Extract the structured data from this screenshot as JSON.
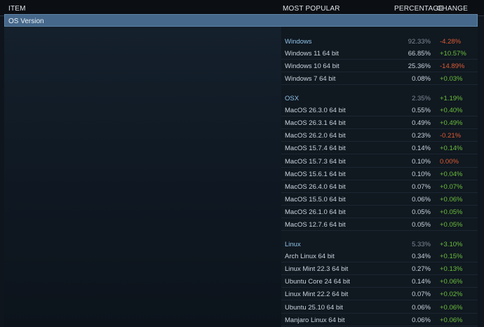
{
  "header": {
    "item": "ITEM",
    "most_popular": "MOST POPULAR",
    "percentage": "PERCENTAGE",
    "change": "CHANGE"
  },
  "section": {
    "title": "OS Version"
  },
  "colors": {
    "positive": "#6bbf3c",
    "negative": "#dc5b35",
    "group": "#8fc2e8",
    "section_bar": "#46688a"
  },
  "groups": [
    {
      "name": "Windows",
      "percentage": "92.33%",
      "change": "-4.28%",
      "rows": [
        {
          "name": "Windows 11 64 bit",
          "percentage": "66.85%",
          "change": "+10.57%"
        },
        {
          "name": "Windows 10 64 bit",
          "percentage": "25.36%",
          "change": "-14.89%"
        },
        {
          "name": "Windows 7 64 bit",
          "percentage": "0.08%",
          "change": "+0.03%"
        }
      ]
    },
    {
      "name": "OSX",
      "percentage": "2.35%",
      "change": "+1.19%",
      "rows": [
        {
          "name": "MacOS 26.3.0 64 bit",
          "percentage": "0.55%",
          "change": "+0.40%"
        },
        {
          "name": "MacOS 26.3.1 64 bit",
          "percentage": "0.49%",
          "change": "+0.49%"
        },
        {
          "name": "MacOS 26.2.0 64 bit",
          "percentage": "0.23%",
          "change": "-0.21%"
        },
        {
          "name": "MacOS 15.7.4 64 bit",
          "percentage": "0.14%",
          "change": "+0.14%"
        },
        {
          "name": "MacOS 15.7.3 64 bit",
          "percentage": "0.10%",
          "change": "0.00%"
        },
        {
          "name": "MacOS 15.6.1 64 bit",
          "percentage": "0.10%",
          "change": "+0.04%"
        },
        {
          "name": "MacOS 26.4.0 64 bit",
          "percentage": "0.07%",
          "change": "+0.07%"
        },
        {
          "name": "MacOS 15.5.0 64 bit",
          "percentage": "0.06%",
          "change": "+0.06%"
        },
        {
          "name": "MacOS 26.1.0 64 bit",
          "percentage": "0.05%",
          "change": "+0.05%"
        },
        {
          "name": "MacOS 12.7.6 64 bit",
          "percentage": "0.05%",
          "change": "+0.05%"
        }
      ]
    },
    {
      "name": "Linux",
      "percentage": "5.33%",
      "change": "+3.10%",
      "rows": [
        {
          "name": "Arch Linux 64 bit",
          "percentage": "0.34%",
          "change": "+0.15%"
        },
        {
          "name": "Linux Mint 22.3 64 bit",
          "percentage": "0.27%",
          "change": "+0.13%"
        },
        {
          "name": "Ubuntu Core 24 64 bit",
          "percentage": "0.14%",
          "change": "+0.06%"
        },
        {
          "name": "Linux Mint 22.2 64 bit",
          "percentage": "0.07%",
          "change": "+0.02%"
        },
        {
          "name": "Ubuntu 25.10 64 bit",
          "percentage": "0.06%",
          "change": "+0.06%"
        },
        {
          "name": "Manjaro Linux 64 bit",
          "percentage": "0.06%",
          "change": "+0.06%"
        }
      ]
    }
  ]
}
